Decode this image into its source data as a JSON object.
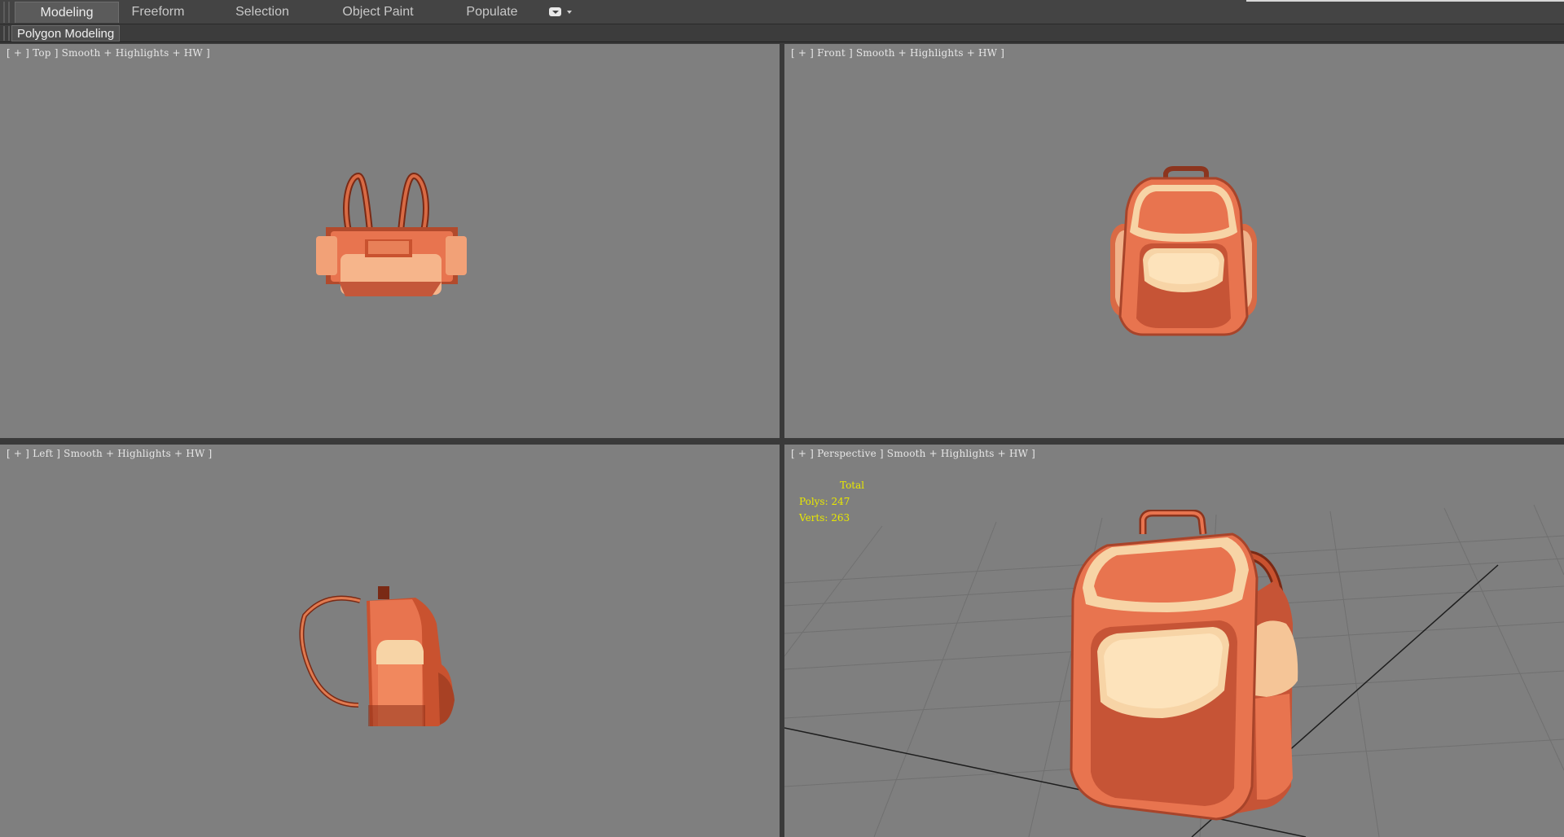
{
  "ribbon": {
    "tabs": [
      {
        "label": "Modeling",
        "active": true
      },
      {
        "label": "Freeform",
        "active": false
      },
      {
        "label": "Selection",
        "active": false
      },
      {
        "label": "Object Paint",
        "active": false
      },
      {
        "label": "Populate",
        "active": false
      }
    ],
    "sub_label": "Polygon Modeling"
  },
  "viewports": {
    "top": {
      "plus": "+",
      "name": "Top",
      "shading": "Smooth + Highlights + HW"
    },
    "front": {
      "plus": "+",
      "name": "Front",
      "shading": "Smooth + Highlights + HW"
    },
    "left": {
      "plus": "+",
      "name": "Left",
      "shading": "Smooth + Highlights + HW"
    },
    "persp": {
      "plus": "+",
      "name": "Perspective",
      "shading": "Smooth + Highlights + HW"
    }
  },
  "stats": {
    "header": "Total",
    "polys_label": "Polys:",
    "polys": "247",
    "verts_label": "Verts:",
    "verts": "263"
  },
  "colors": {
    "viewport_bg": "#7f7f7f",
    "bag_main": "#e8744f",
    "bag_dark": "#9a3b22",
    "bag_light": "#f6d2a4",
    "stats_text": "#e8e800"
  }
}
